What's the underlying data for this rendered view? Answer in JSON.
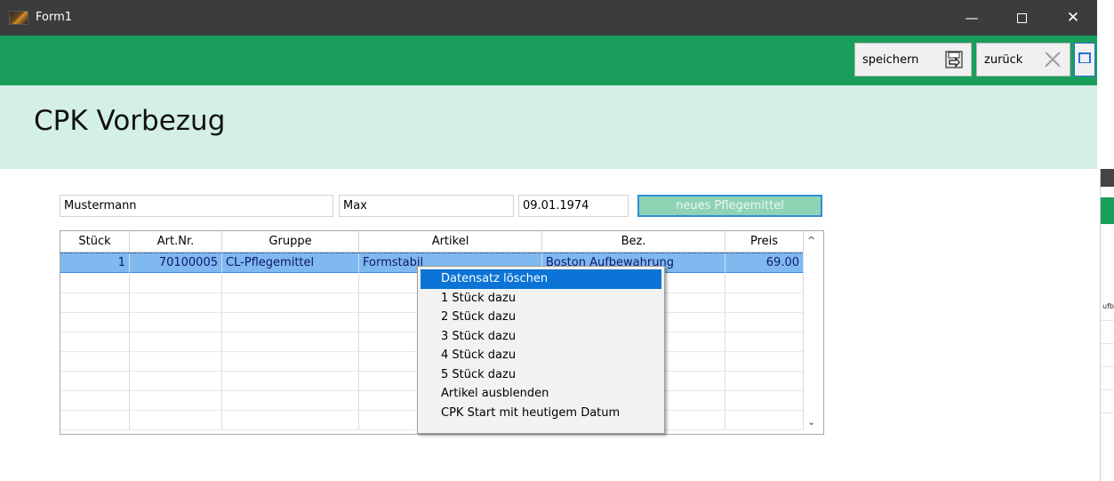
{
  "window": {
    "title": "Form1",
    "min_glyph": "—",
    "close_glyph": "✕"
  },
  "toolbar": {
    "save_label": "speichern",
    "back_label": "zurück"
  },
  "header": {
    "title": "CPK Vorbezug"
  },
  "form": {
    "last_name": "Mustermann",
    "first_name": "Max",
    "birth_date": "09.01.1974",
    "new_button_label": "neues Pflegemittel"
  },
  "grid": {
    "columns": [
      "Stück",
      "Art.Nr.",
      "Gruppe",
      "Artikel",
      "Bez.",
      "Preis"
    ],
    "rows": [
      {
        "stueck": "1",
        "artnr": "70100005",
        "gruppe": "CL-Pflegemittel",
        "artikel": "Formstabil",
        "bez": "Boston Aufbewahrung",
        "preis": "69.00"
      }
    ],
    "scroll_up": "^",
    "scroll_down": "⌄"
  },
  "context_menu": {
    "items": [
      "Datensatz löschen",
      "1 Stück dazu",
      "2 Stück dazu",
      "3 Stück dazu",
      "4 Stück dazu",
      "5 Stück dazu",
      "Artikel ausblenden",
      "CPK Start mit heutigem Datum"
    ],
    "active_index": 0
  },
  "background_window": {
    "partial_text": "ufb"
  },
  "colors": {
    "titlebar": "#3c3c3c",
    "toolbar_green": "#1a9e5c",
    "header_mint": "#d4f0e6",
    "selection_blue": "#80b8f0",
    "menu_highlight": "#0b74d6"
  }
}
